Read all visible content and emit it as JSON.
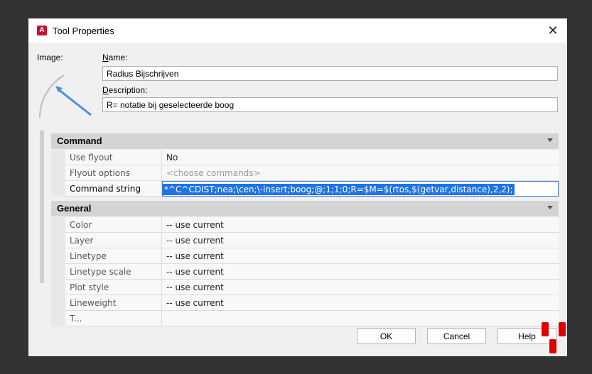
{
  "window": {
    "title": "Tool Properties",
    "close_glyph": "✕",
    "app_icon_letter": "A"
  },
  "form": {
    "image_label": "Image:",
    "name_label_u": "N",
    "name_label_rest": "ame:",
    "name_value": "Radius Bijschrijven",
    "desc_label_u": "D",
    "desc_label_rest": "escription:",
    "desc_value": "R= notatie bij geselecteerde boog"
  },
  "sections": {
    "command": {
      "title": "Command",
      "rows": [
        {
          "name": "Use flyout",
          "value": "No"
        },
        {
          "name": "Flyout options",
          "value": "<choose commands>"
        },
        {
          "name": "Command string",
          "value": "*^C^CDIST;nea;\\cen;\\-insert;boog;@;1;1;0;R=$M=$(rtos,$(getvar,distance),2,2);"
        }
      ]
    },
    "general": {
      "title": "General",
      "rows": [
        {
          "name": "Color",
          "value": "-- use current"
        },
        {
          "name": "Layer",
          "value": "-- use current"
        },
        {
          "name": "Linetype",
          "value": "-- use current"
        },
        {
          "name": "Linetype scale",
          "value": "-- use current"
        },
        {
          "name": "Plot style",
          "value": "-- use current"
        },
        {
          "name": "Lineweight",
          "value": "-- use current"
        },
        {
          "name": "T...",
          "value": ""
        }
      ]
    }
  },
  "buttons": {
    "ok": "OK",
    "cancel": "Cancel",
    "help": "Help"
  },
  "colors": {
    "accent": "#1e73e8",
    "brand": "#c8102e",
    "grip": "#e00000"
  }
}
